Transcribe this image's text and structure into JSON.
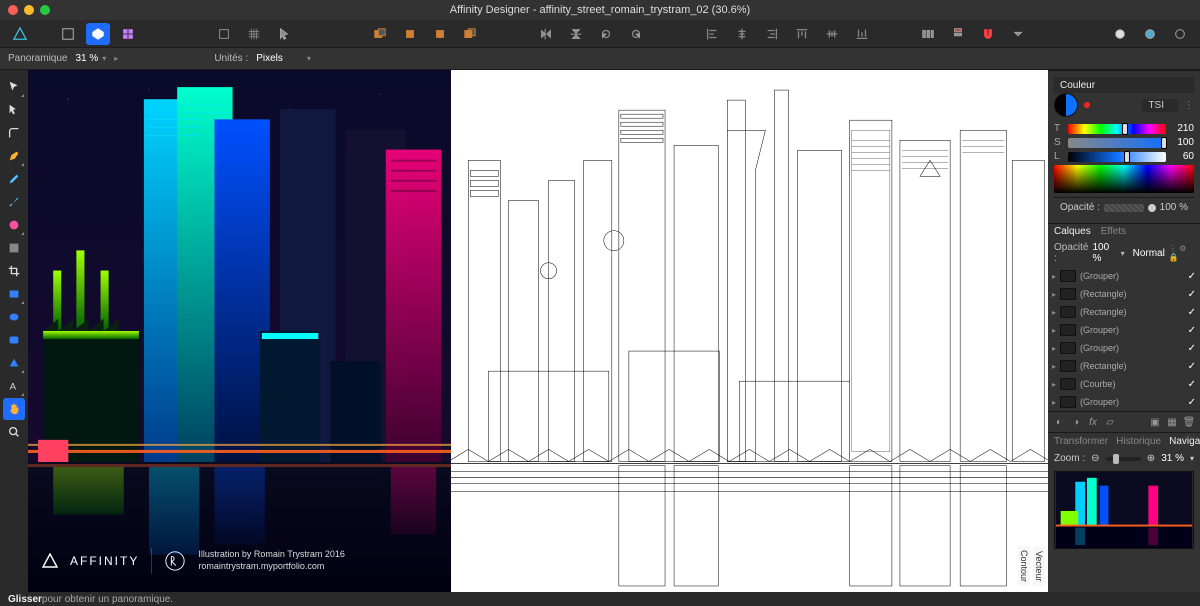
{
  "app_title": "Affinity Designer - affinity_street_romain_trystram_02 (30.6%)",
  "context_toolbar": {
    "label_left": "Panoramique",
    "zoom_value": "31 %",
    "units_label": "Unités :",
    "units_value": "Pixels"
  },
  "colour_panel": {
    "title": "Couleur",
    "mode": "TSI",
    "t_label": "T",
    "t_value": "210",
    "s_label": "S",
    "s_value": "100",
    "l_label": "L",
    "l_value": "60",
    "opacity_label": "Opacité :",
    "opacity_value": "100 %"
  },
  "layers_panel": {
    "tabs": [
      "Calques",
      "Effets"
    ],
    "opacity_label": "Opacité :",
    "opacity_value": "100 %",
    "blend_mode": "Normal",
    "layers": [
      {
        "name": "(Grouper)"
      },
      {
        "name": "(Rectangle)"
      },
      {
        "name": "(Rectangle)"
      },
      {
        "name": "(Grouper)"
      },
      {
        "name": "(Grouper)"
      },
      {
        "name": "(Rectangle)"
      },
      {
        "name": "(Courbe)"
      },
      {
        "name": "(Grouper)"
      }
    ],
    "fx_label": "fx"
  },
  "navigator_panel": {
    "tabs": [
      "Transformer",
      "Historique",
      "Navigateur"
    ],
    "zoom_label": "Zoom :",
    "zoom_value": "31 %"
  },
  "status_bar": {
    "bold": "Glisser",
    "rest": " pour obtenir un panoramique."
  },
  "credits": {
    "brand": "AFFINITY",
    "line1": "Illustration by Romain Trystram 2016",
    "line2": "romaintrystram.myportfolio.com"
  },
  "wire_tabs": [
    "Vecteur",
    "Contour"
  ]
}
